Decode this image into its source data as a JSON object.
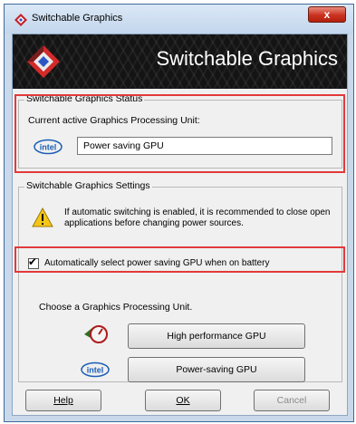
{
  "window": {
    "title": "Switchable Graphics",
    "close_label": "x"
  },
  "banner": {
    "title": "Switchable Graphics"
  },
  "status": {
    "group_title": "Switchable Graphics Status",
    "current_label": "Current active Graphics Processing Unit:",
    "current_value": "Power saving GPU",
    "logo_text": "intel"
  },
  "settings": {
    "group_title": "Switchable Graphics Settings",
    "warning_text_line1": "If automatic switching is enabled, it is recommended to close open",
    "warning_text_line2": "applications before changing power sources.",
    "auto_checkbox_checked": true,
    "auto_checkbox_label": "Automatically select power saving GPU when on battery",
    "choose_label": "Choose a Graphics Processing Unit.",
    "high_perf_button": "High performance GPU",
    "power_saving_button": "Power-saving GPU",
    "logo_text": "intel"
  },
  "footer": {
    "help_button": "Help",
    "ok_button": "OK",
    "cancel_button": "Cancel"
  },
  "colors": {
    "highlight": "#e23a3a",
    "banner_bg": "#141414"
  },
  "icons": {
    "app": "amd-icon",
    "banner": "amd-logo-icon",
    "warning": "warning-icon",
    "high_perf": "gauge-icon",
    "intel": "intel-logo-icon"
  }
}
